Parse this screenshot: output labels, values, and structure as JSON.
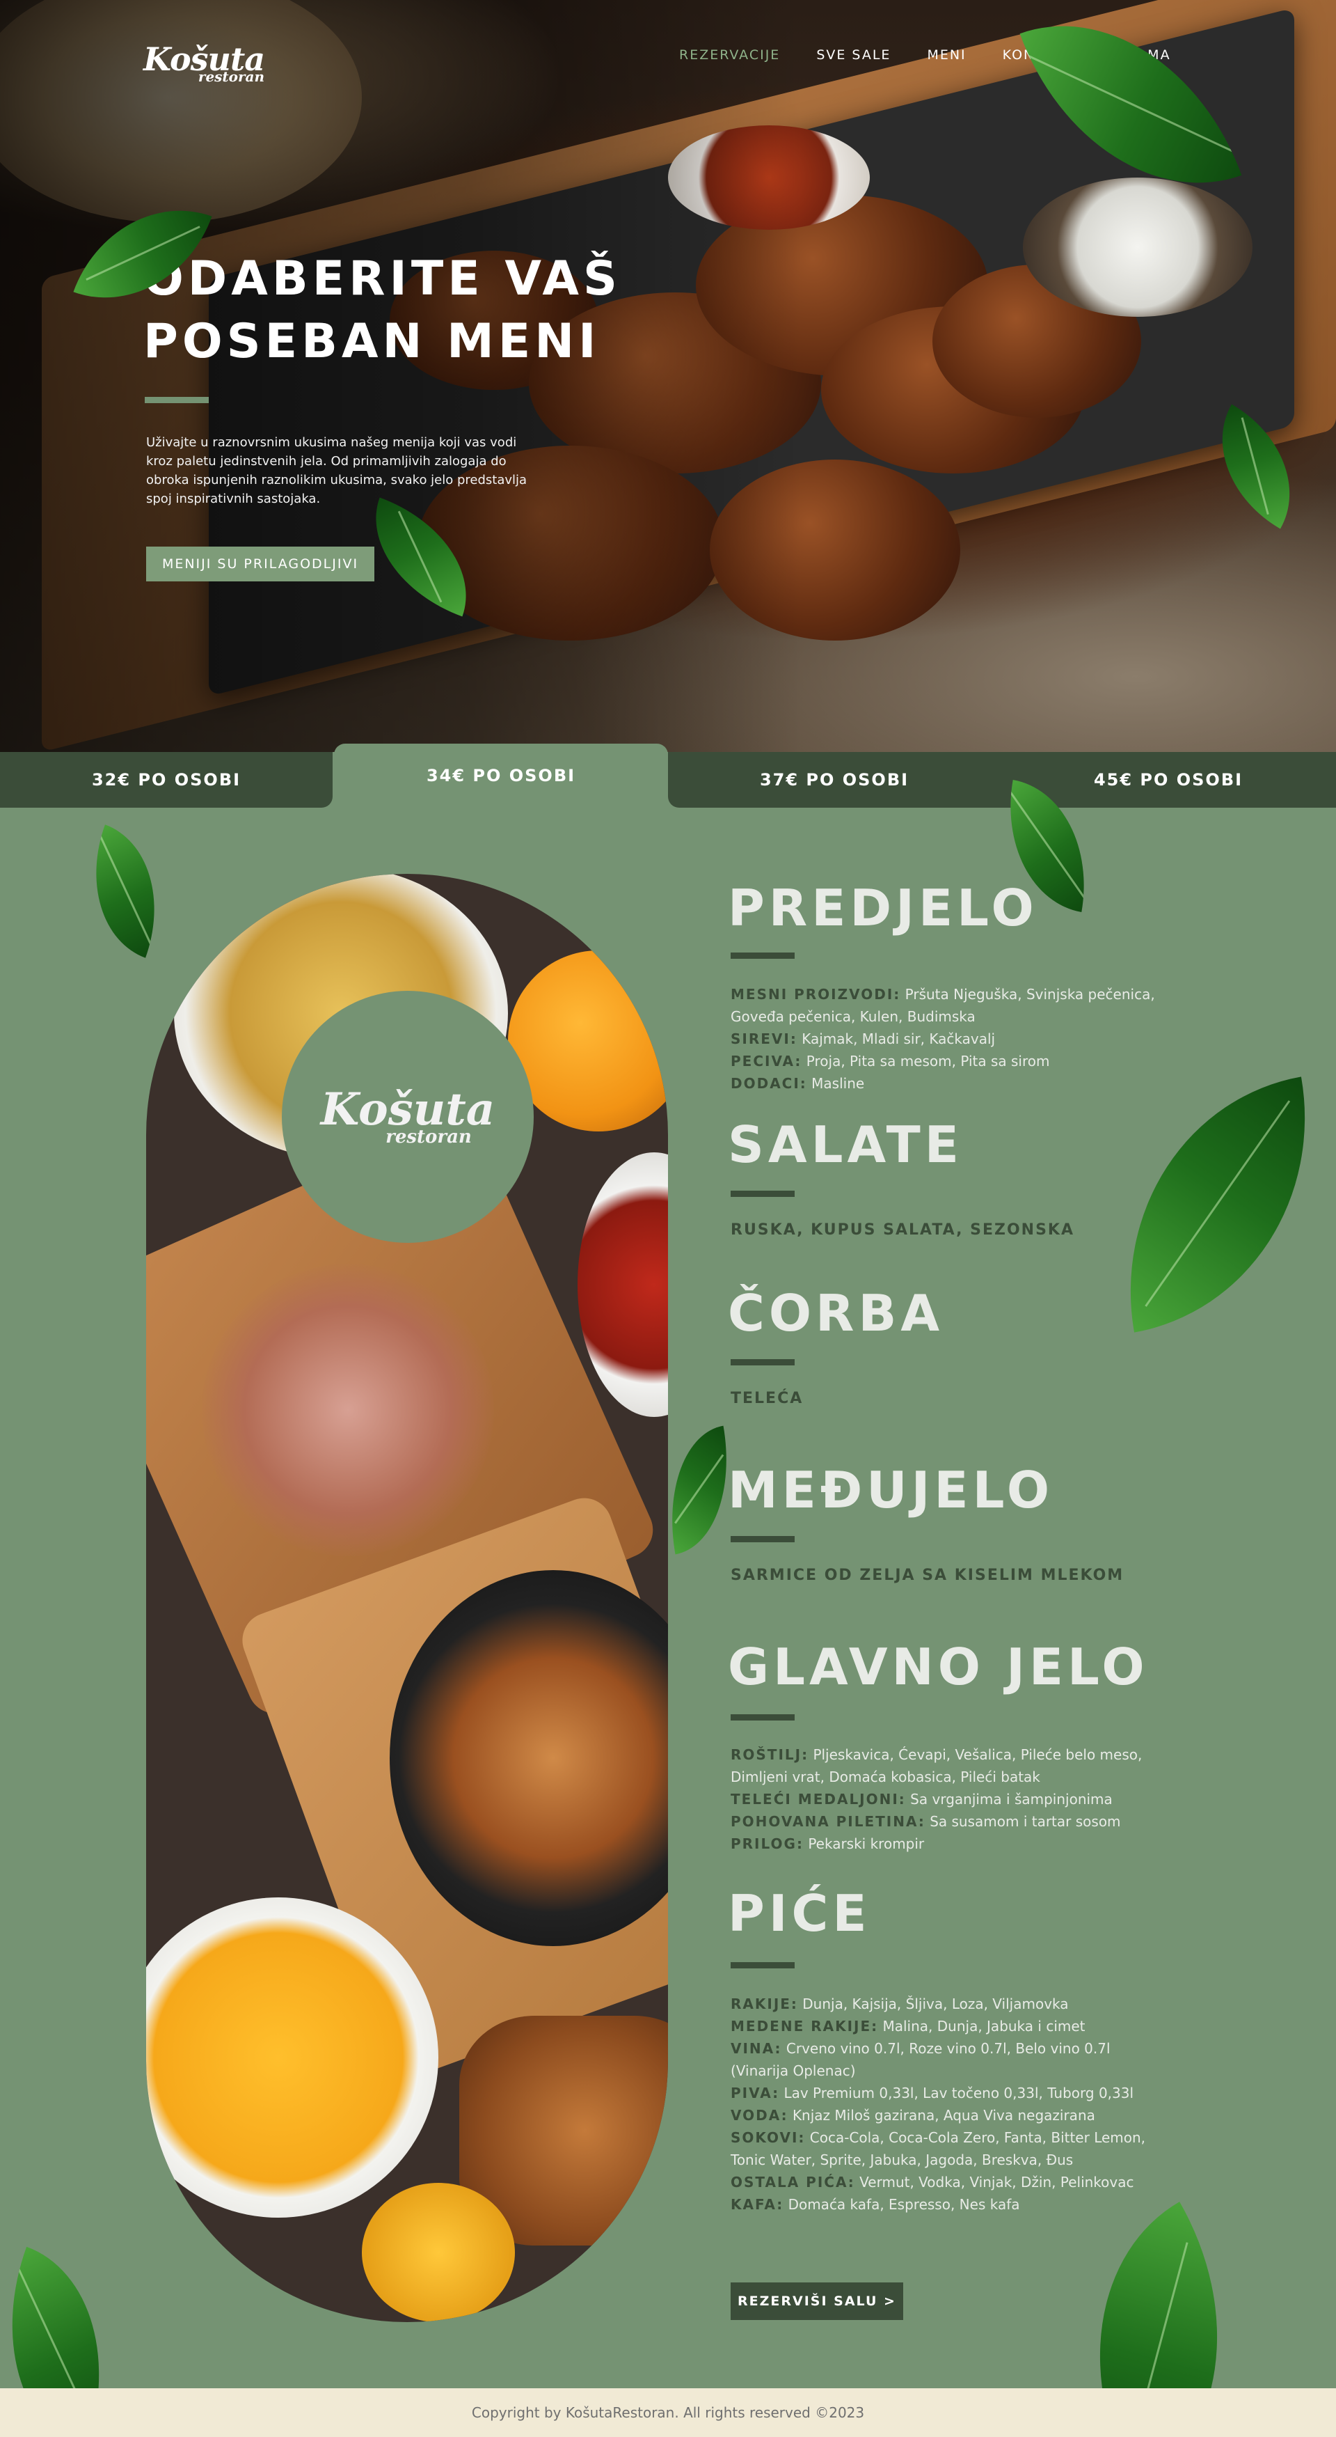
{
  "brand": {
    "name": "Košuta",
    "sub": "restoran"
  },
  "nav": [
    {
      "label": "REZERVACIJE",
      "active": true
    },
    {
      "label": "SVE SALE",
      "active": false
    },
    {
      "label": "MENI",
      "active": false
    },
    {
      "label": "KONTAKT",
      "active": false
    },
    {
      "label": "O NAMA",
      "active": false
    }
  ],
  "hero": {
    "title_line1": "ODABERITE VAŠ",
    "title_line2": "POSEBAN MENI",
    "text": "Uživajte u raznovrsnim ukusima našeg menija koji vas vodi kroz paletu jedinstvenih jela. Od primamljivih zalogaja do obroka ispunjenih raznolikim ukusima, svako jelo predstavlja spoj inspirativnih sastojaka.",
    "button": "MENIJI SU PRILAGODLJIVI"
  },
  "tabs": [
    {
      "label": "32€ PO OSOBI",
      "active": false
    },
    {
      "label": "34€ PO OSOBI",
      "active": true
    },
    {
      "label": "37€ PO OSOBI",
      "active": false
    },
    {
      "label": "45€ PO OSOBI",
      "active": false
    }
  ],
  "menu": {
    "predjelo": {
      "title": "PREDJELO",
      "items": [
        {
          "k": "MESNI PROIZVODI:",
          "v": "Pršuta Njeguška, Svinjska pečenica, Goveđa pečenica, Kulen, Budimska"
        },
        {
          "k": "SIREVI:",
          "v": "Kajmak, Mladi sir, Kačkavalj"
        },
        {
          "k": "PECIVA:",
          "v": "Proja, Pita sa mesom, Pita sa sirom"
        },
        {
          "k": "DODACI:",
          "v": "Masline"
        }
      ]
    },
    "salate": {
      "title": "SALATE",
      "text": "RUSKA, KUPUS SALATA, SEZONSKA"
    },
    "corba": {
      "title": "ČORBA",
      "text": "TELEĆA"
    },
    "medjujelo": {
      "title": "MEĐUJELO",
      "text": "SARMICE OD ZELJA SA KISELIM MLEKOM"
    },
    "glavno": {
      "title": "GLAVNO JELO",
      "items": [
        {
          "k": "ROŠTILJ:",
          "v": "Pljeskavica, Ćevapi, Vešalica, Pileće belo meso, Dimljeni vrat, Domaća kobasica, Pileći batak"
        },
        {
          "k": "TELEĆI MEDALJONI:",
          "v": "Sa vrganjima i šampinjonima"
        },
        {
          "k": "POHOVANA PILETINA:",
          "v": "Sa susamom i tartar sosom"
        },
        {
          "k": "PRILOG:",
          "v": "Pekarski krompir"
        }
      ]
    },
    "pice": {
      "title": "PIĆE",
      "items": [
        {
          "k": "RAKIJE:",
          "v": "Dunja, Kajsija, Šljiva, Loza, Viljamovka"
        },
        {
          "k": "MEDENE RAKIJE:",
          "v": "Malina, Dunja, Jabuka i cimet"
        },
        {
          "k": "VINA:",
          "v": "Crveno vino 0.7l, Roze vino 0.7l, Belo vino 0.7l (Vinarija Oplenac)"
        },
        {
          "k": "PIVA:",
          "v": "Lav Premium 0,33l, Lav točeno 0,33l, Tuborg 0,33l"
        },
        {
          "k": "VODA:",
          "v": "Knjaz Miloš gazirana, Aqua Viva negazirana"
        },
        {
          "k": "SOKOVI:",
          "v": "Coca-Cola, Coca-Cola Zero, Fanta, Bitter Lemon, Tonic Water, Sprite, Jabuka, Jagoda, Breskva, Đus"
        },
        {
          "k": "OSTALA PIĆA:",
          "v": "Vermut, Vodka, Vinjak, Džin, Pelinkovac"
        },
        {
          "k": "KAFA:",
          "v": "Domaća kafa, Espresso, Nes kafa"
        }
      ]
    }
  },
  "cta": "REZERVIŠI SALU >",
  "footer": "Copyright by KošutaRestoran. All rights reserved ©2023",
  "colors": {
    "green": "#759373",
    "dark_green": "#3b4d39",
    "cream": "#f1ead5"
  },
  "icons": [
    "leaf-icon"
  ]
}
